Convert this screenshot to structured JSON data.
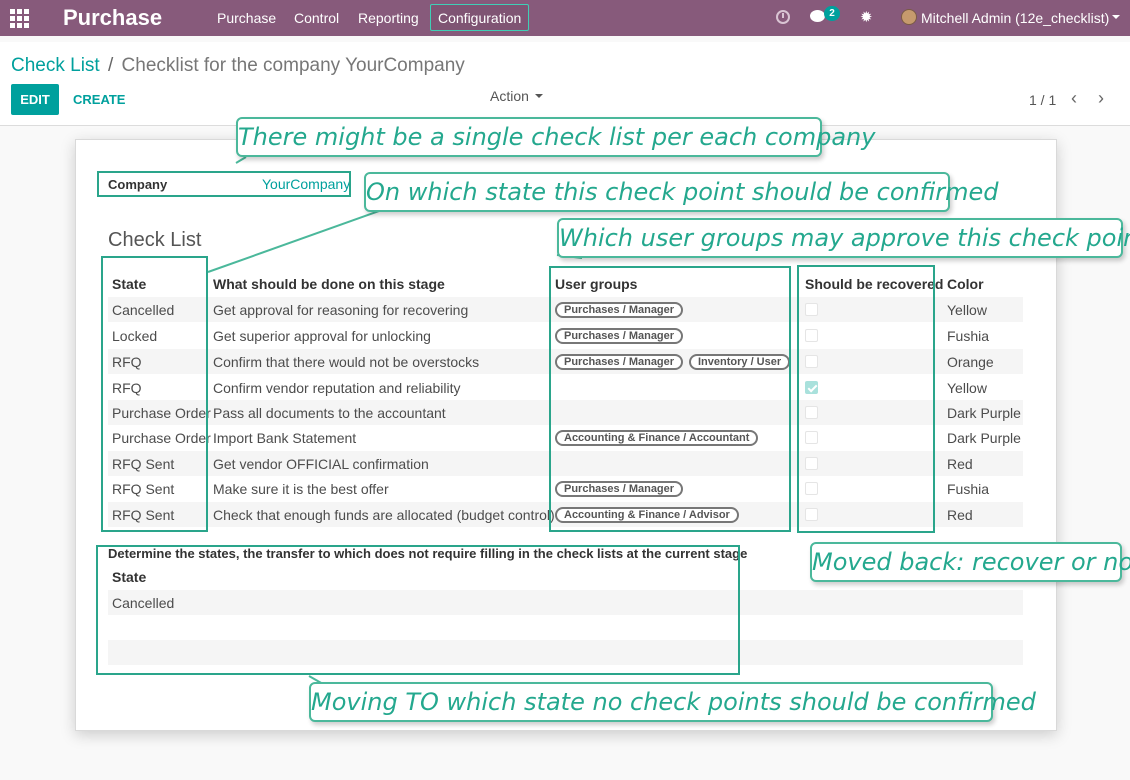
{
  "navbar": {
    "app_name": "Purchase",
    "menu": [
      "Purchase",
      "Control",
      "Reporting",
      "Configuration"
    ],
    "chat_count": "2",
    "user": "Mitchell Admin (12e_checklist)",
    "accent_color": "#875a7b"
  },
  "breadcrumb": {
    "parent": "Check List",
    "separator": "/",
    "current": "Checklist for the company YourCompany"
  },
  "buttons": {
    "edit": "EDIT",
    "create": "CREATE",
    "action": "Action"
  },
  "pager": {
    "value": "1 / 1",
    "prev": "‹",
    "next": "›"
  },
  "form": {
    "company_label": "Company",
    "company_value": "YourCompany",
    "section_title": "Check List",
    "columns": [
      "State",
      "What should be done on this stage",
      "User groups",
      "Should be recovered",
      "Color"
    ],
    "rows": [
      {
        "state": "Cancelled",
        "what": "Get approval for reasoning for recovering",
        "groups": [
          "Purchases / Manager"
        ],
        "recovered": false,
        "color": "Yellow"
      },
      {
        "state": "Locked",
        "what": "Get superior approval for unlocking",
        "groups": [
          "Purchases / Manager"
        ],
        "recovered": false,
        "color": "Fushia"
      },
      {
        "state": "RFQ",
        "what": "Confirm that there would not be overstocks",
        "groups": [
          "Purchases / Manager",
          "Inventory / User"
        ],
        "recovered": false,
        "color": "Orange"
      },
      {
        "state": "RFQ",
        "what": "Confirm vendor reputation and reliability",
        "groups": [],
        "recovered": true,
        "color": "Yellow"
      },
      {
        "state": "Purchase Order",
        "what": "Pass all documents to the accountant",
        "groups": [],
        "recovered": false,
        "color": "Dark Purple"
      },
      {
        "state": "Purchase Order",
        "what": "Import Bank Statement",
        "groups": [
          "Accounting & Finance / Accountant"
        ],
        "recovered": false,
        "color": "Dark Purple"
      },
      {
        "state": "RFQ Sent",
        "what": "Get vendor OFFICIAL confirmation",
        "groups": [],
        "recovered": false,
        "color": "Red"
      },
      {
        "state": "RFQ Sent",
        "what": "Make sure it is the best offer",
        "groups": [
          "Purchases / Manager"
        ],
        "recovered": false,
        "color": "Fushia"
      },
      {
        "state": "RFQ Sent",
        "what": "Check that enough funds are allocated (budget control)",
        "groups": [
          "Accounting & Finance / Advisor"
        ],
        "recovered": false,
        "color": "Red"
      }
    ],
    "no_check_title": "Determine the states, the transfer to which does not require filling in the check lists at the current stage",
    "no_check_header": "State",
    "no_check_rows": [
      "Cancelled"
    ]
  },
  "callouts": {
    "single_list": "There might be a single check list per each company",
    "state_confirm": "On which state this check point should be confirmed",
    "user_groups": "Which user groups may approve this check point",
    "moved_back": "Moved back: recover or not?",
    "moving_to": "Moving TO which state no check points should be confirmed"
  },
  "annotation_color": "#2aa58b"
}
